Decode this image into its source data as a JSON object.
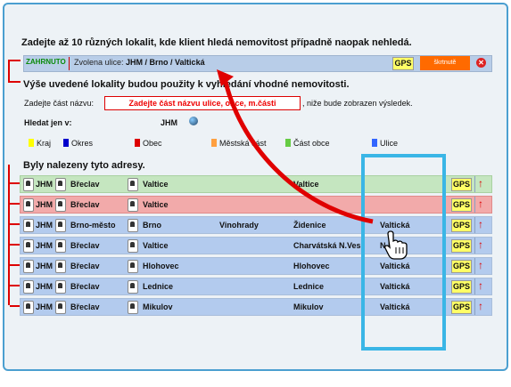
{
  "intro": "Zadejte až 10 různých lokalit, kde klient hledá nemovitost případně naopak nehledá.",
  "selected": {
    "tag": "ZAHRNUTO",
    "label": "Zvolena ulice:",
    "value": "JHM / Brno / Valtická",
    "gps": "GPS",
    "strike": "škrtnutě",
    "remove": "✕"
  },
  "line2": "Výše uvedené lokality budou použity k vyhledání  vhodné nemovitosti.",
  "search": {
    "label": "Zadejte  část názvu:",
    "placeholder": "Zadejte část názvu ulice, obce, m.části",
    "hint": ", niže bude zobrazen výsledek."
  },
  "filter": {
    "label": "Hledat jen v:",
    "value": "JHM"
  },
  "legend": [
    {
      "label": "Kraj",
      "color": "#ffff00"
    },
    {
      "label": "Okres",
      "color": "#0000cc"
    },
    {
      "label": "Obec",
      "color": "#dd0000"
    },
    {
      "label": "Městská část",
      "color": "#ffa040"
    },
    {
      "label": "Část obce",
      "color": "#66cc44"
    },
    {
      "label": "Ulice",
      "color": "#3366ff"
    }
  ],
  "results_title": "Byly nalezeny tyto adresy.",
  "rows": [
    {
      "kraj": "JHM",
      "okres": "Břeclav",
      "obec": "Valtice",
      "mc": "",
      "co": "Valtice",
      "ulice": "",
      "gps": "GPS",
      "state": "green"
    },
    {
      "kraj": "JHM",
      "okres": "Břeclav",
      "obec": "Valtice",
      "mc": "",
      "co": "",
      "ulice": "",
      "gps": "GPS",
      "state": "red"
    },
    {
      "kraj": "JHM",
      "okres": "Brno-město",
      "obec": "Brno",
      "mc": "Vinohrady",
      "co": "Židenice",
      "ulice": "Valtická",
      "gps": "GPS",
      "state": "blue"
    },
    {
      "kraj": "JHM",
      "okres": "Břeclav",
      "obec": "Valtice",
      "mc": "",
      "co": "Charvátská N.Ves",
      "ulice": "N     ké",
      "gps": "GPS",
      "state": "blue"
    },
    {
      "kraj": "JHM",
      "okres": "Břeclav",
      "obec": "Hlohovec",
      "mc": "",
      "co": "Hlohovec",
      "ulice": "Valtická",
      "gps": "GPS",
      "state": "blue"
    },
    {
      "kraj": "JHM",
      "okres": "Břeclav",
      "obec": "Lednice",
      "mc": "",
      "co": "Lednice",
      "ulice": "Valtická",
      "gps": "GPS",
      "state": "blue"
    },
    {
      "kraj": "JHM",
      "okres": "Břeclav",
      "obec": "Mikulov",
      "mc": "",
      "co": "Mikulov",
      "ulice": "Valtická",
      "gps": "GPS",
      "state": "blue"
    }
  ],
  "colors": {
    "accent": "#4b9fd0",
    "highlight": "#3ab6e6",
    "arrow": "#e00000",
    "row": "#b3cbee",
    "rowGreen": "#c5e6c0",
    "rowRed": "#f2aaaa"
  }
}
